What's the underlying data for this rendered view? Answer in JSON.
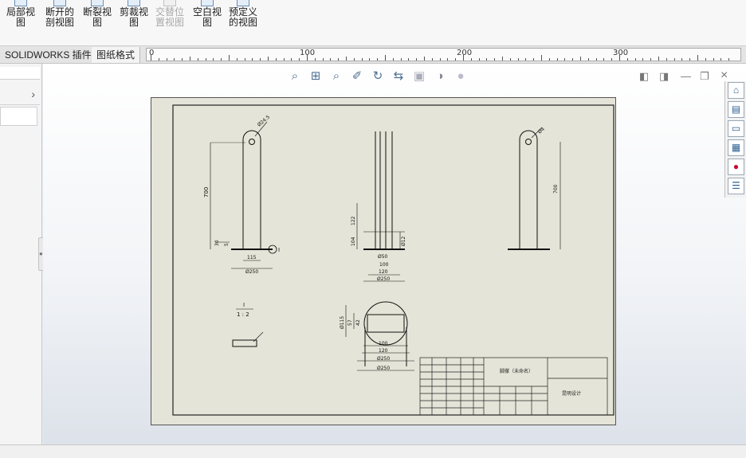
{
  "ribbon": {
    "buttons": [
      {
        "name": "detail-view-button",
        "label": "局部视图",
        "disabled": false
      },
      {
        "name": "broken-out-section-button",
        "label": "断开的剖视图",
        "disabled": false
      },
      {
        "name": "break-view-button",
        "label": "断裂视图",
        "disabled": false
      },
      {
        "name": "crop-view-button",
        "label": "剪裁视图",
        "disabled": false
      },
      {
        "name": "alternate-position-view-button",
        "label": "交替位置视图",
        "disabled": true
      },
      {
        "name": "empty-view-button",
        "label": "空白视图",
        "disabled": false
      },
      {
        "name": "predefined-view-button",
        "label": "预定义的视图",
        "disabled": false
      }
    ]
  },
  "tabs": {
    "addins": "SOLIDWORKS 插件",
    "sheet_format": "图纸格式"
  },
  "ruler": {
    "labels": [
      "0",
      "100",
      "200",
      "300"
    ]
  },
  "window": {
    "close": "×"
  },
  "drawing": {
    "front": {
      "dia_top": "Ø24.5",
      "height": "700",
      "dim_30": "30",
      "dim_5": "5",
      "width_115": "115",
      "dia_250": "Ø250",
      "section_mark": "I"
    },
    "side": {
      "dim_122": "122",
      "dim_104": "104",
      "dim_12": "Ø12",
      "dim_50": "Ø50",
      "dim_100": "100",
      "dim_120": "120",
      "dia_250": "Ø250"
    },
    "right": {
      "dia_top": "Ø4",
      "height": "700"
    },
    "detail": {
      "label": "I",
      "scale": "1 : 2"
    },
    "top": {
      "dia_115": "Ø115",
      "dim_57": "57",
      "dim_42": "42",
      "dim_100": "100",
      "dim_120": "120",
      "dia_250a": "Ø250",
      "dia_250b": "Ø250"
    },
    "title_block": {
      "part_name": "脚撑（未命名）",
      "company": "昆明设计"
    }
  }
}
